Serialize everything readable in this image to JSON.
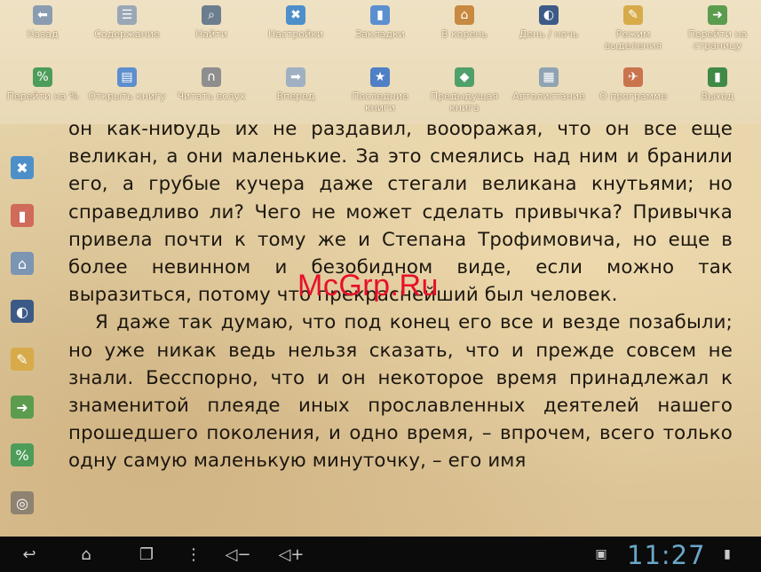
{
  "menu": {
    "row1": [
      {
        "label": "Назад",
        "icon": "back-arrow-icon",
        "glyph": "⬅",
        "color": "#8a9cb0"
      },
      {
        "label": "Содержание",
        "icon": "contents-list-icon",
        "glyph": "☰",
        "color": "#9aa7b6"
      },
      {
        "label": "Найти",
        "icon": "binoculars-icon",
        "glyph": "⌕",
        "color": "#6c7d8e"
      },
      {
        "label": "Настройки",
        "icon": "tools-icon",
        "glyph": "✖",
        "color": "#4d8fc9"
      },
      {
        "label": "Закладки",
        "icon": "bookmark-icon",
        "glyph": "▮",
        "color": "#5b8fd0"
      },
      {
        "label": "В корень",
        "icon": "root-icon",
        "glyph": "⌂",
        "color": "#c88940"
      },
      {
        "label": "День / ночь",
        "icon": "day-night-icon",
        "glyph": "◐",
        "color": "#3c5a86"
      },
      {
        "label": "Режим выделения",
        "icon": "highlighter-icon",
        "glyph": "✎",
        "color": "#d8ab4a"
      },
      {
        "label": "Перейти на страницу",
        "icon": "goto-page-icon",
        "glyph": "➜",
        "color": "#5c9c4e"
      }
    ],
    "row2": [
      {
        "label": "Перейти на %",
        "icon": "goto-percent-icon",
        "glyph": "%",
        "color": "#4e9c5a"
      },
      {
        "label": "Открыть книгу",
        "icon": "open-book-folder-icon",
        "glyph": "▤",
        "color": "#5d8fcf"
      },
      {
        "label": "Читать вслух",
        "icon": "headphones-icon",
        "glyph": "∩",
        "color": "#8e8e8e"
      },
      {
        "label": "Вперед",
        "icon": "forward-arrow-icon",
        "glyph": "➡",
        "color": "#9fb0c2"
      },
      {
        "label": "Последние книги",
        "icon": "recent-books-icon",
        "glyph": "★",
        "color": "#4f7fc4"
      },
      {
        "label": "Предыдущая книга",
        "icon": "previous-book-icon",
        "glyph": "◆",
        "color": "#4fa06a"
      },
      {
        "label": "Автолистание",
        "icon": "autoscroll-icon",
        "glyph": "▦",
        "color": "#8fa3b3"
      },
      {
        "label": "О программе",
        "icon": "about-icon",
        "glyph": "✈",
        "color": "#c9744d"
      },
      {
        "label": "Выход",
        "icon": "exit-icon",
        "glyph": "▮",
        "color": "#3f8a47"
      }
    ]
  },
  "left_toolbar": [
    {
      "icon": "tools-icon",
      "glyph": "✖",
      "color": "#4d8fc9"
    },
    {
      "icon": "bookmark-icon",
      "glyph": "▮",
      "color": "#d06a5a"
    },
    {
      "icon": "root-icon",
      "glyph": "⌂",
      "color": "#7b95b3"
    },
    {
      "icon": "day-night-icon",
      "glyph": "◐",
      "color": "#3c5a86"
    },
    {
      "icon": "highlighter-icon",
      "glyph": "✎",
      "color": "#d8ab4a"
    },
    {
      "icon": "goto-page-icon",
      "glyph": "➜",
      "color": "#5c9c4e"
    },
    {
      "icon": "goto-percent-icon",
      "glyph": "%",
      "color": "#4e9c5a"
    },
    {
      "icon": "more-icon",
      "glyph": "◎",
      "color": "#8e8270"
    }
  ],
  "book": {
    "paragraph1": "он как-нибудь их не раздавил, воображая, что он все еще великан, а они маленькие. За это смеялись над ним и бранили его, а грубые кучера даже стегали великана кнутьями; но справедливо ли? Чего не может сделать привычка? Привычка привела почти к тому же и Степана Трофимовича, но еще в более невинном и безобидном виде, если можно так выразиться, потому что прекраснейший был человек.",
    "paragraph2": "Я даже так думаю, что под конец его все и везде позабыли; но уже никак ведь нельзя сказать, что и прежде совсем не знали. Бесспорно, что и он некоторое время принадлежал к знаменитой плеяде иных прославленных деятелей нашего прошедшего поколения, и одно время, – впрочем, всего только одну самую маленькую минуточку, – его имя"
  },
  "watermark": "McGrp.Ru",
  "status_bar": {
    "time": "11:27",
    "buttons": [
      {
        "icon": "back-icon",
        "glyph": "↩"
      },
      {
        "icon": "home-icon",
        "glyph": "⌂"
      },
      {
        "icon": "recent-apps-icon",
        "glyph": "❐"
      },
      {
        "icon": "menu-dots-icon",
        "glyph": "⋮"
      },
      {
        "icon": "volume-down-icon",
        "glyph": "◁−"
      },
      {
        "icon": "volume-up-icon",
        "glyph": "◁+"
      }
    ],
    "indicators": [
      {
        "icon": "screenshot-icon",
        "glyph": "▣"
      },
      {
        "icon": "signal-battery-icon",
        "glyph": "▮"
      }
    ]
  }
}
